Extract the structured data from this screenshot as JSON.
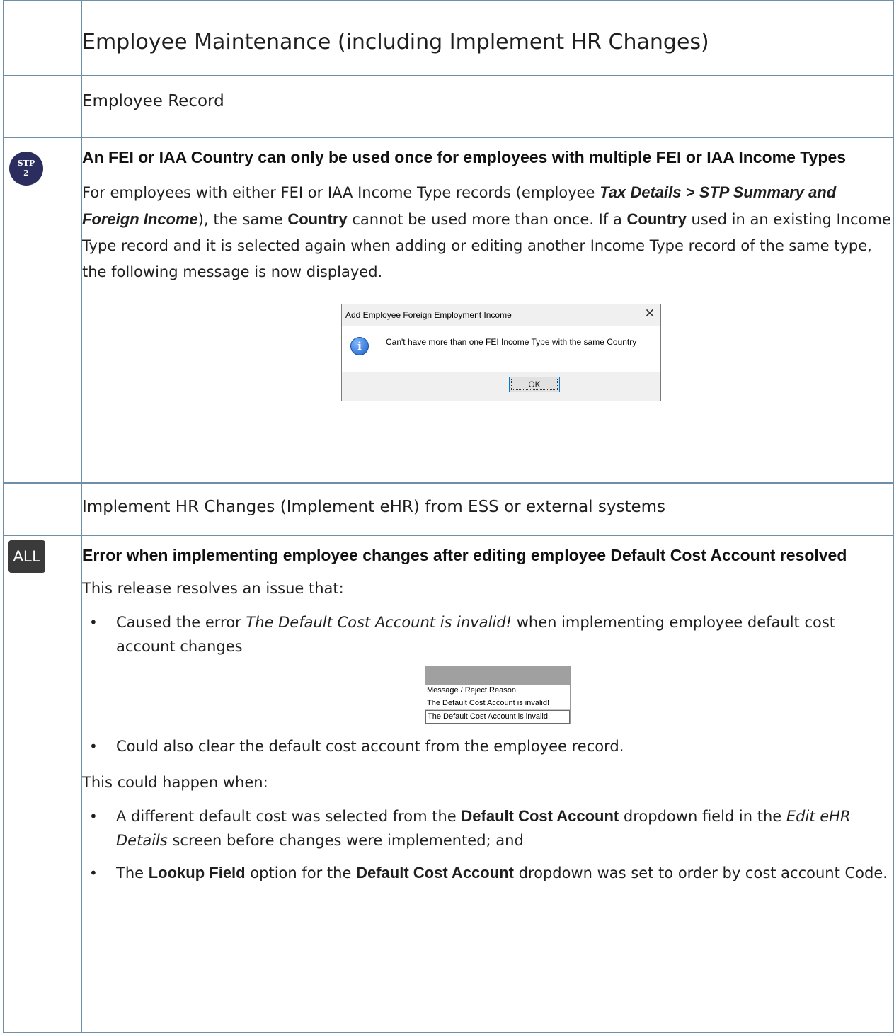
{
  "section_title": "Employee Maintenance (including Implement HR Changes)",
  "employee_record": {
    "heading": "Employee Record",
    "badge_line1": "STP",
    "badge_line2": "2",
    "item_title": "An FEI or IAA Country can only be used once for employees with multiple FEI or IAA Income Types",
    "p1_a": "For employees with either FEI or IAA Income Type records (employee ",
    "p1_italic": "Tax Details > STP Summary and Foreign Income",
    "p1_b": "), the same ",
    "p1_bold_country": "Country",
    "p1_c": " cannot be used more than once. If a ",
    "p1_bold_country2": "Country",
    "p1_d": " used in an existing Income Type record and it is selected again when adding or editing another Income Type record of the same type, the following message is now displayed.",
    "dialog": {
      "title": "Add Employee Foreign Employment Income",
      "close": "✕",
      "message": "Can't have more than one FEI Income Type with the same Country",
      "ok": "OK"
    }
  },
  "implement_hr": {
    "heading": "Implement HR Changes (Implement eHR) from ESS or external systems",
    "badge": "ALL",
    "item_title": "Error when implementing employee changes after editing employee Default Cost Account resolved",
    "intro": "This release resolves an issue that:",
    "bullet1_a": "Caused the error ",
    "bullet1_italic": "The Default Cost Account is invalid!",
    "bullet1_b": " when implementing employee default cost account changes",
    "grid": {
      "column": "Message / Reject Reason",
      "rows": [
        "The Default Cost Account is invalid!",
        "The Default Cost Account is invalid!"
      ]
    },
    "bullet2": "Could also clear the default cost account from the employee record.",
    "when": "This could happen when:",
    "bullet3_a": "A different default cost was selected from the ",
    "bullet3_bold": "Default Cost Account",
    "bullet3_b": " dropdown field in the ",
    "bullet3_italic": "Edit eHR Details",
    "bullet3_c": " screen before changes were implemented; and",
    "bullet4_a": "The ",
    "bullet4_bold1": "Lookup Field",
    "bullet4_b": " option for the ",
    "bullet4_bold2": "Default Cost Account",
    "bullet4_c": " dropdown was set to order by cost account Code."
  }
}
